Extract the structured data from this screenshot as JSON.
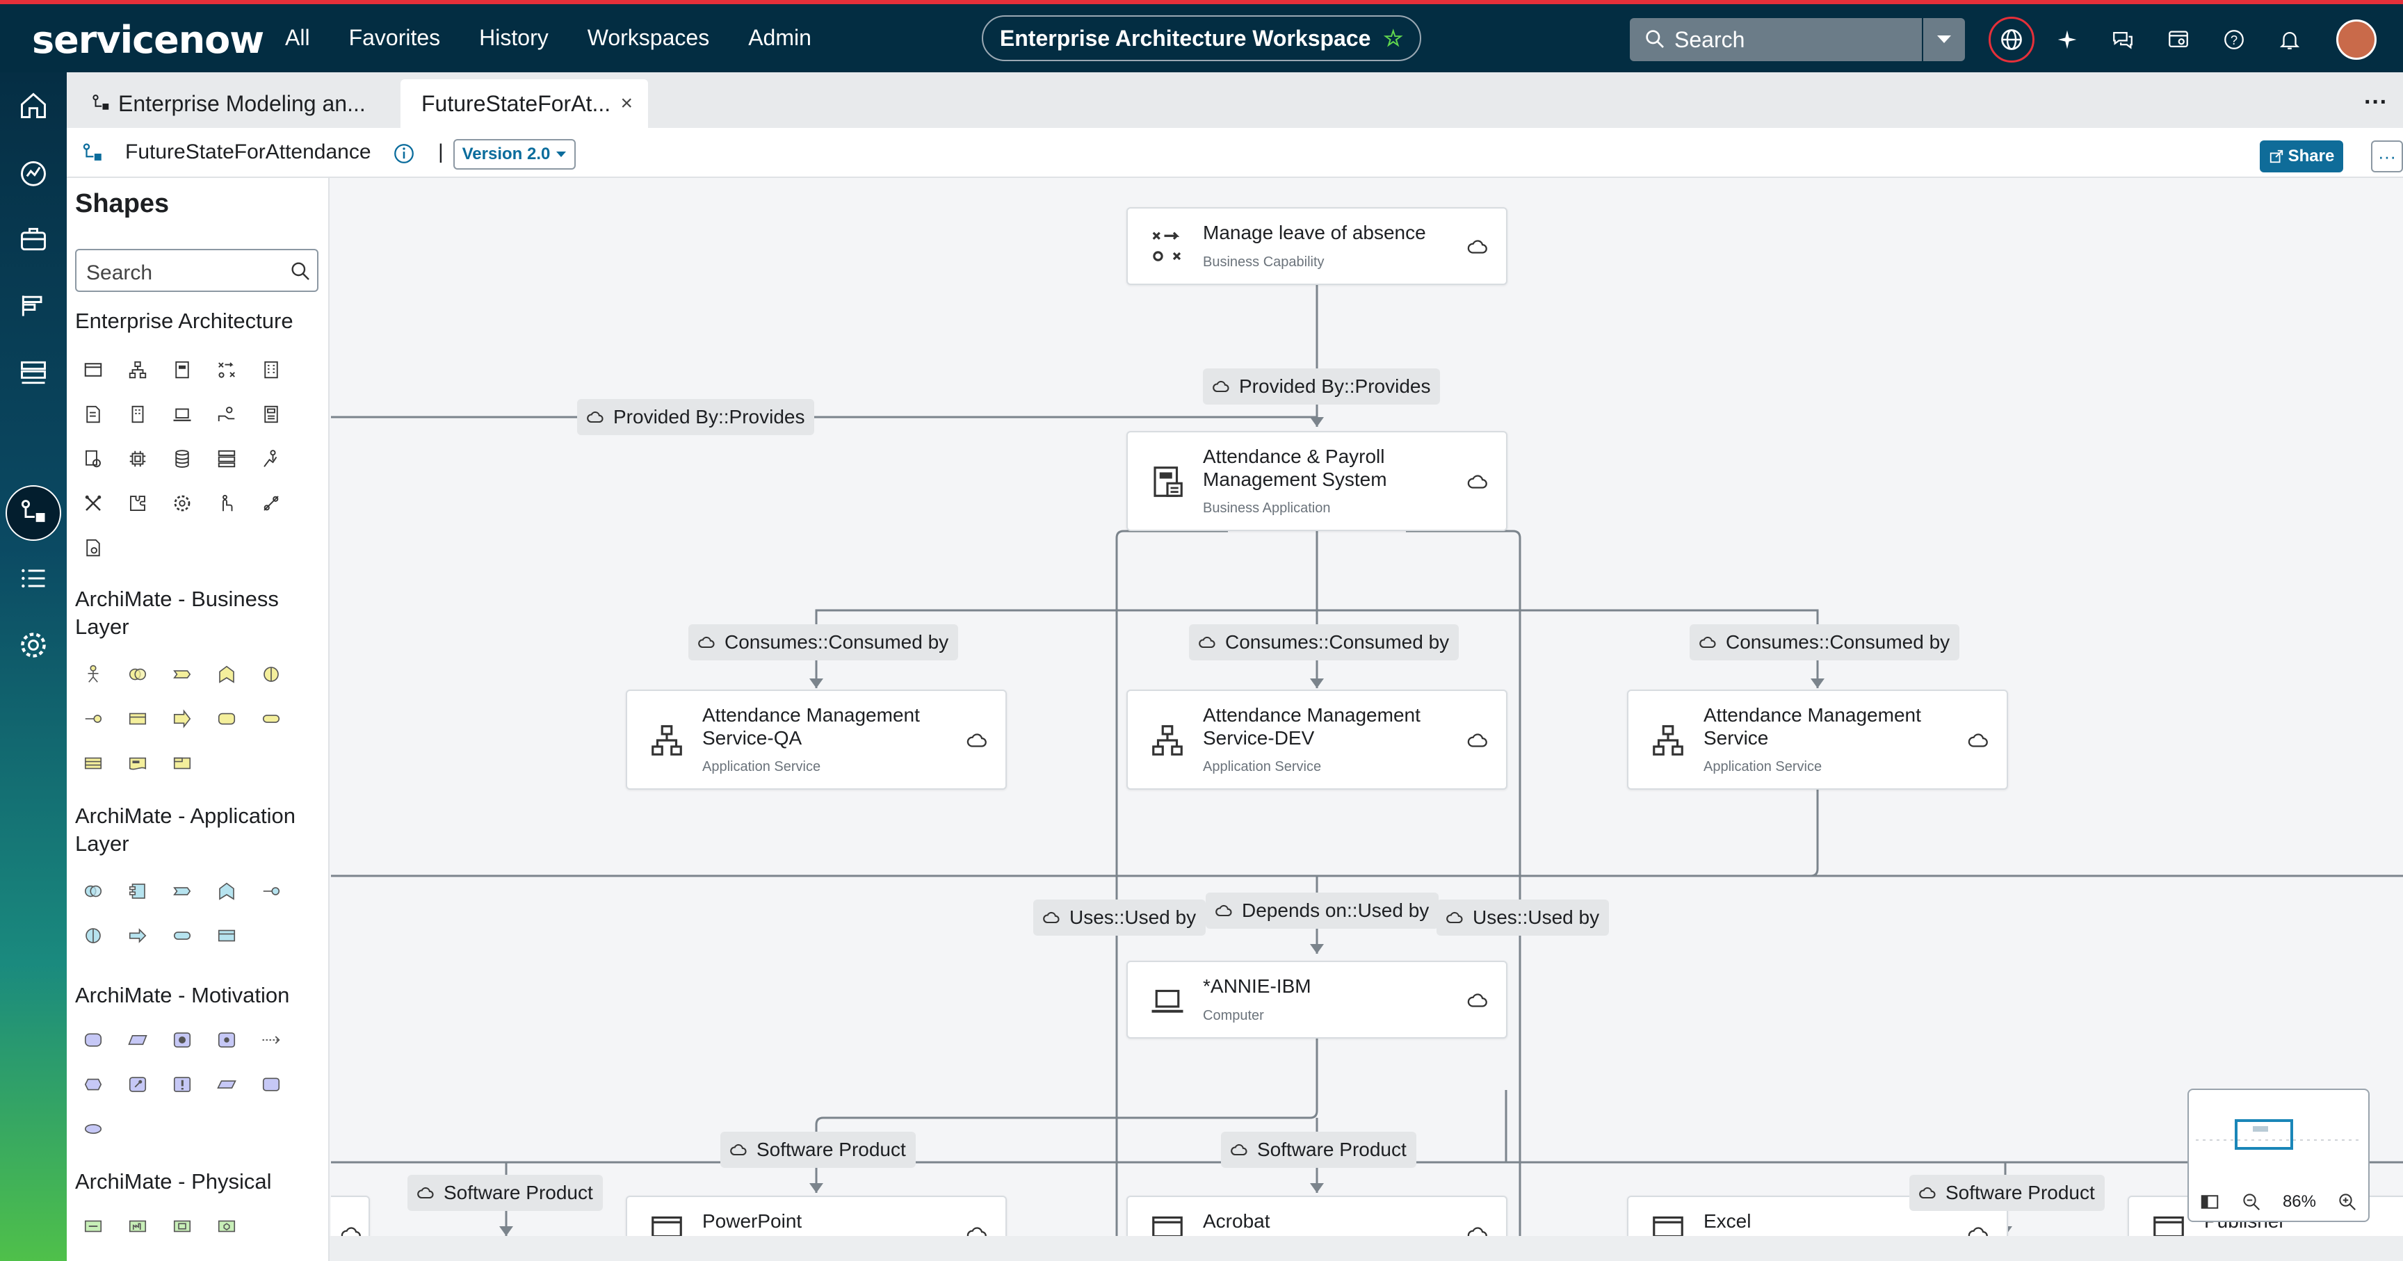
{
  "topbar": {
    "logo": "servicenow",
    "nav": [
      "All",
      "Favorites",
      "History",
      "Workspaces",
      "Admin"
    ],
    "workspace_title": "Enterprise Architecture Workspace",
    "search_label": "Search",
    "accent": "#62d84e"
  },
  "tabs": [
    {
      "label": "Enterprise Modeling an..."
    },
    {
      "label": "FutureStateForAt..."
    }
  ],
  "docbar": {
    "title": "FutureStateForAttendance",
    "separator": "|",
    "version": "Version 2.0",
    "share": "Share",
    "more": "···"
  },
  "shapes_panel": {
    "title": "Shapes",
    "search_placeholder": "Search",
    "categories": [
      {
        "label": "Enterprise Architecture"
      },
      {
        "label": "ArchiMate - Business Layer"
      },
      {
        "label": "ArchiMate - Application Layer"
      },
      {
        "label": "ArchiMate - Motivation"
      },
      {
        "label": "ArchiMate - Physical"
      }
    ]
  },
  "nodes": [
    {
      "title": "Manage leave of absence",
      "subtitle": "Business Capability"
    },
    {
      "title": "Attendance & Payroll Management System",
      "subtitle": "Business Application"
    },
    {
      "title": "Attendance Management Service-QA",
      "subtitle": "Application Service"
    },
    {
      "title": "Attendance Management Service-DEV",
      "subtitle": "Application Service"
    },
    {
      "title": "Attendance Management Service",
      "subtitle": "Application Service"
    },
    {
      "title": "*ANNIE-IBM",
      "subtitle": "Computer"
    },
    {
      "title": "PowerPoint",
      "subtitle": ""
    },
    {
      "title": "Acrobat",
      "subtitle": ""
    },
    {
      "title": "Excel",
      "subtitle": ""
    },
    {
      "title": "Publisher",
      "subtitle": ""
    }
  ],
  "relations": [
    "Provided By::Provides",
    "Provided By::Provides",
    "Consumes::Consumed by",
    "Consumes::Consumed by",
    "Consumes::Consumed by",
    "Uses::Used by",
    "Depends on::Used by",
    "Uses::Used by",
    "Software Product",
    "Software Product",
    "Software Product",
    "Software Product"
  ],
  "minimap": {
    "zoom": "86%"
  }
}
